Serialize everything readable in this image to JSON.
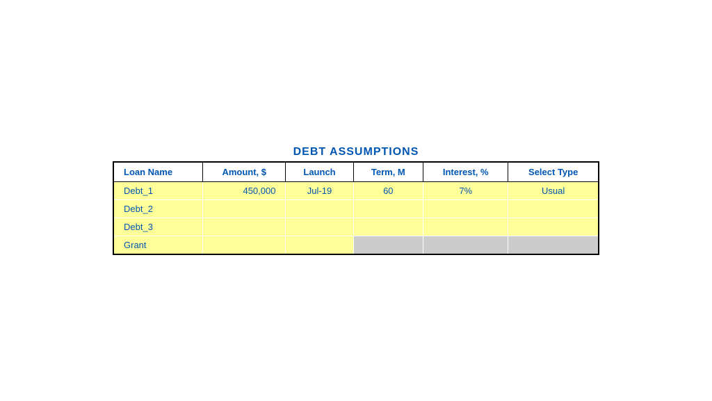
{
  "title": "DEBT ASSUMPTIONS",
  "columns": [
    {
      "key": "loan_name",
      "label": "Loan Name",
      "align": "left"
    },
    {
      "key": "amount",
      "label": "Amount, $",
      "align": "right"
    },
    {
      "key": "launch",
      "label": "Launch",
      "align": "center"
    },
    {
      "key": "term",
      "label": "Term, M",
      "align": "center"
    },
    {
      "key": "interest",
      "label": "Interest, %",
      "align": "center"
    },
    {
      "key": "select_type",
      "label": "Select Type",
      "align": "center"
    }
  ],
  "rows": [
    {
      "loan_name": "Debt_1",
      "amount": "450,000",
      "launch": "Jul-19",
      "term": "60",
      "interest": "7%",
      "select_type": "Usual",
      "gray_cols": []
    },
    {
      "loan_name": "Debt_2",
      "amount": "",
      "launch": "",
      "term": "",
      "interest": "",
      "select_type": "",
      "gray_cols": []
    },
    {
      "loan_name": "Debt_3",
      "amount": "",
      "launch": "",
      "term": "",
      "interest": "",
      "select_type": "",
      "gray_cols": []
    },
    {
      "loan_name": "Grant",
      "amount": "",
      "launch": "",
      "term": "GRAY",
      "interest": "GRAY",
      "select_type": "GRAY",
      "gray_cols": [
        "term",
        "interest",
        "select_type"
      ]
    }
  ]
}
